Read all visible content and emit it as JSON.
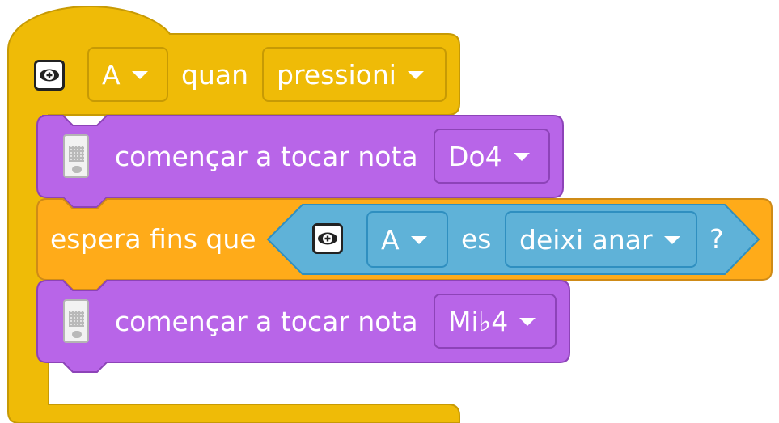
{
  "colors": {
    "event_yellow": "#efbb07",
    "sound_purple": "#b865e8",
    "control_orange": "#ffab19",
    "sensing_blue": "#5fb2d8"
  },
  "hat_block": {
    "icon": "hub-button-icon",
    "button_value": "A",
    "text": "quan",
    "event_value": "pressioni"
  },
  "play_note_block_1": {
    "icon": "light-matrix-hub-icon",
    "text": "començar a tocar nota",
    "note_value": "Do4"
  },
  "wait_until_block": {
    "text": "espera fins que",
    "condition": {
      "icon": "hub-button-icon",
      "button_value": "A",
      "text": "es",
      "state_value": "deixi anar",
      "suffix": "?"
    }
  },
  "play_note_block_2": {
    "icon": "light-matrix-hub-icon",
    "text": "començar a tocar nota",
    "note_value": "Mi♭4"
  }
}
